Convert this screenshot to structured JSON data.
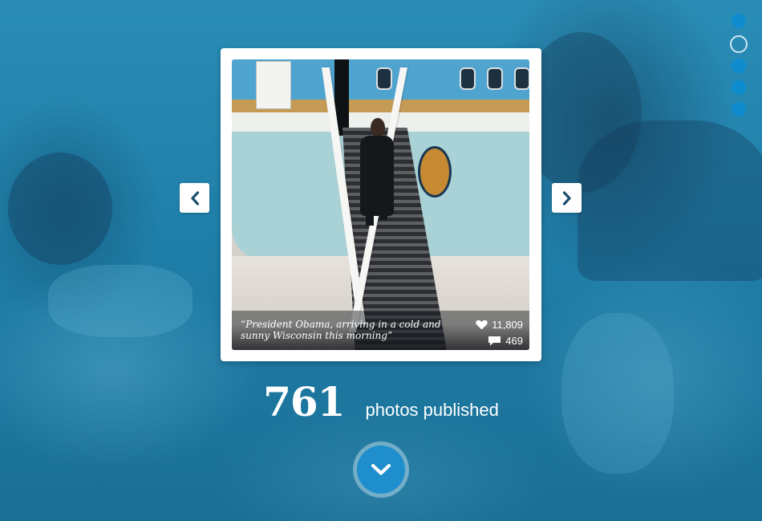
{
  "pager": {
    "dots": [
      {
        "state": "filled"
      },
      {
        "state": "active"
      },
      {
        "state": "filled"
      },
      {
        "state": "filled"
      },
      {
        "state": "filled"
      }
    ]
  },
  "photo_card": {
    "caption": "“President Obama, arriving in a cold and sunny Wisconsin this morning”",
    "likes": "11,809",
    "comments": "469",
    "like_icon": "heart-icon",
    "comment_icon": "comment-icon"
  },
  "nav": {
    "prev_icon": "chevron-left-icon",
    "next_icon": "chevron-right-icon"
  },
  "stats": {
    "count": "761",
    "label": "photos published"
  },
  "scroll": {
    "icon": "chevron-down-icon"
  },
  "colors": {
    "accent": "#1e8fcc",
    "background": "#1f7fa9"
  }
}
